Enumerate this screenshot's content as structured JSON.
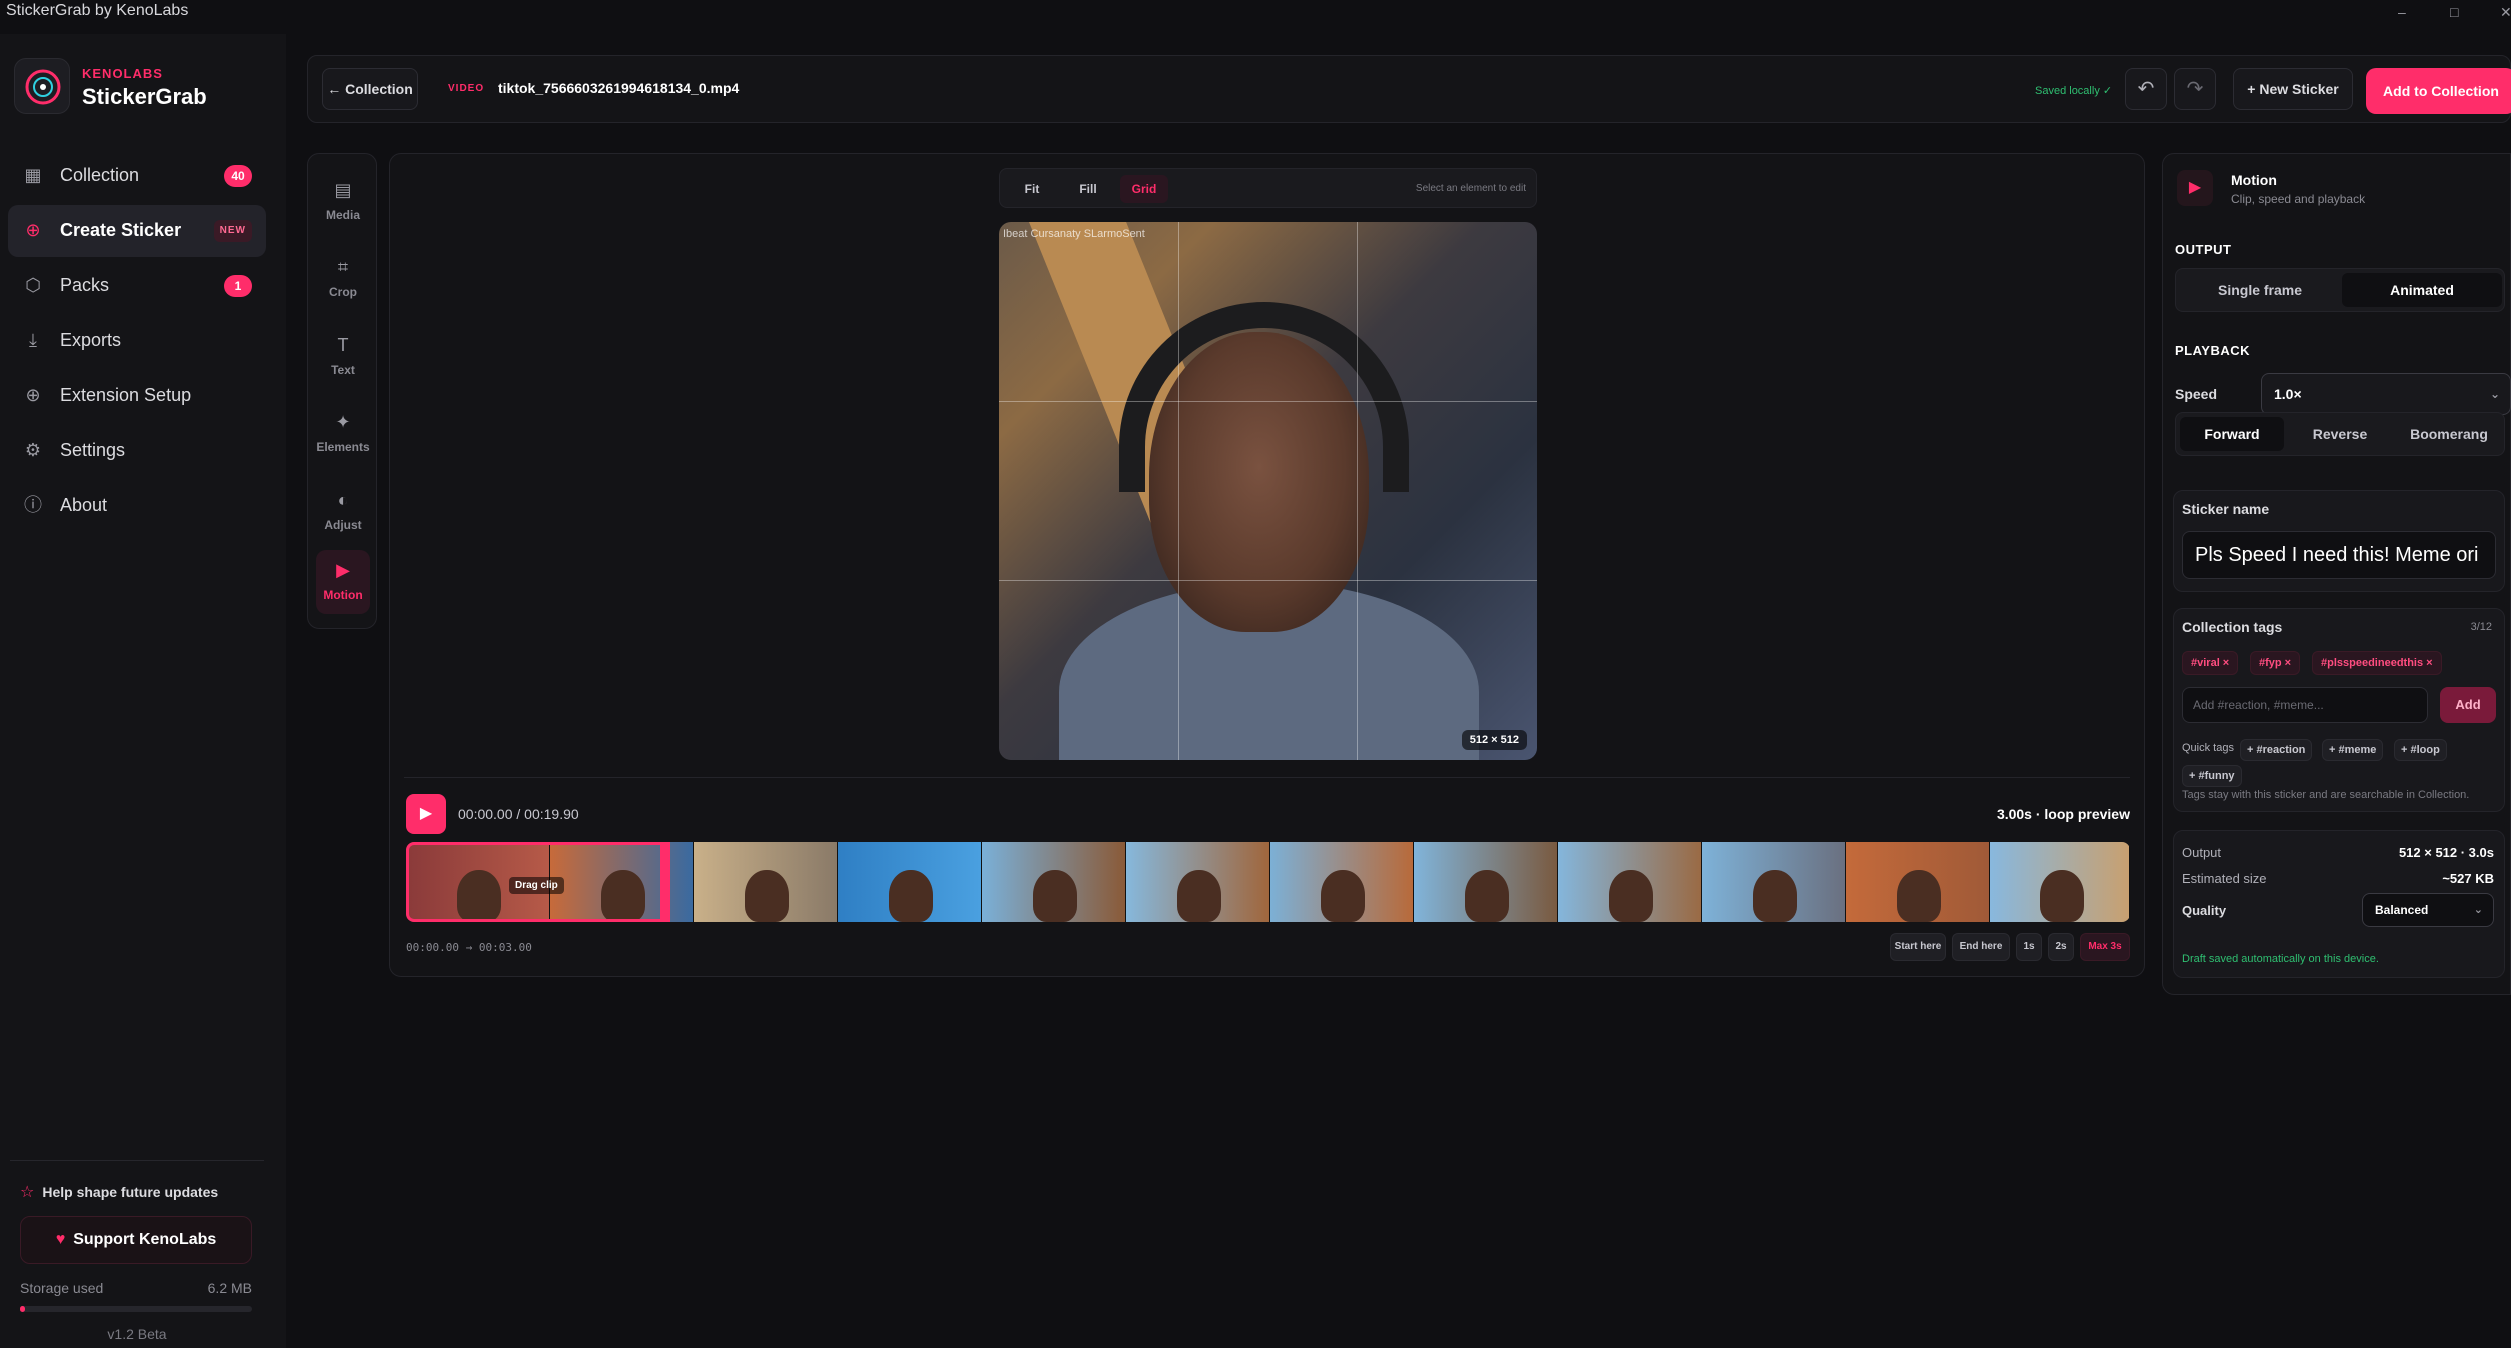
{
  "window": {
    "title": "StickerGrab by KenoLabs",
    "controls": [
      "–",
      "□",
      "✕"
    ]
  },
  "brand": {
    "company": "KENOLABS",
    "app": "StickerGrab"
  },
  "sidebar": {
    "items": [
      {
        "label": "Collection",
        "icon": "grid-icon",
        "badge": "40"
      },
      {
        "label": "Create Sticker",
        "icon": "plus-circle-icon",
        "badge": "NEW",
        "active": true
      },
      {
        "label": "Packs",
        "icon": "box-icon",
        "badge": "1"
      },
      {
        "label": "Exports",
        "icon": "download-icon",
        "badge": ""
      },
      {
        "label": "Extension Setup",
        "icon": "extension-icon",
        "badge": ""
      },
      {
        "label": "Settings",
        "icon": "gear-icon",
        "badge": ""
      },
      {
        "label": "About",
        "icon": "info-icon",
        "badge": ""
      }
    ],
    "help": "Help shape future updates",
    "support": "Support KenoLabs",
    "storage_label": "Storage used",
    "storage_value": "6.2 MB",
    "storage_fraction": 0.02,
    "version": "v1.2 Beta"
  },
  "header": {
    "back": "← Collection",
    "video_tag": "VIDEO",
    "filename": "tiktok_7566603261994618134_0.mp4",
    "saved": "Saved locally ✓",
    "new_sticker": "+ New Sticker",
    "add_to_collection": "Add to Collection"
  },
  "tools": [
    {
      "label": "Media",
      "icon": "▤"
    },
    {
      "label": "Crop",
      "icon": "⌗"
    },
    {
      "label": "Text",
      "icon": "T"
    },
    {
      "label": "Elements",
      "icon": "✦"
    },
    {
      "label": "Adjust",
      "icon": "◐"
    },
    {
      "label": "Motion",
      "icon": "▶",
      "active": true
    }
  ],
  "editor": {
    "fit_options": [
      "Fit",
      "Fill",
      "Grid"
    ],
    "active_fit": "Grid",
    "select_hint": "Select an element to edit",
    "watermark": "Ibeat Cursanaty SLarmoSent",
    "canvas_size": "512 × 512",
    "time": "00:00.00 / 00:19.90",
    "loop_info": "3.00s · loop preview",
    "drag_clip": "Drag clip",
    "range": "00:00.00 → 00:03.00",
    "buttons": [
      "Start here",
      "End here",
      "1s",
      "2s",
      "Max 3s"
    ]
  },
  "panel": {
    "title": "Motion",
    "subtitle": "Clip, speed and playback",
    "output_heading": "OUTPUT",
    "output_options": [
      "Single frame",
      "Animated"
    ],
    "output_active": "Animated",
    "playback_heading": "PLAYBACK",
    "speed_label": "Speed",
    "speed_value": "1.0×",
    "direction_options": [
      "Forward",
      "Reverse",
      "Boomerang"
    ],
    "direction_active": "Forward",
    "sticker_name_label": "Sticker name",
    "sticker_name": "Pls Speed I need this! Meme ori",
    "tags_label": "Collection tags",
    "tags_count": "3/12",
    "tags": [
      "#viral ×",
      "#fyp ×",
      "#plsspeedineedthis ×"
    ],
    "tag_placeholder": "Add #reaction, #meme...",
    "tag_add": "Add",
    "quick_tags_label": "Quick tags",
    "quick_tags": [
      "+ #reaction",
      "+ #meme",
      "+ #loop",
      "+ #funny"
    ],
    "tags_hint": "Tags stay with this sticker and are searchable in Collection.",
    "output_label": "Output",
    "output_value": "512 × 512 · 3.0s",
    "size_label": "Estimated size",
    "size_value": "~527 KB",
    "quality_label": "Quality",
    "quality_value": "Balanced",
    "draft_note": "Draft saved automatically on this device."
  },
  "colors": {
    "accent": "#ff2d6a",
    "background": "#0f0f12",
    "panel": "#141417",
    "success": "#2fbf71"
  }
}
